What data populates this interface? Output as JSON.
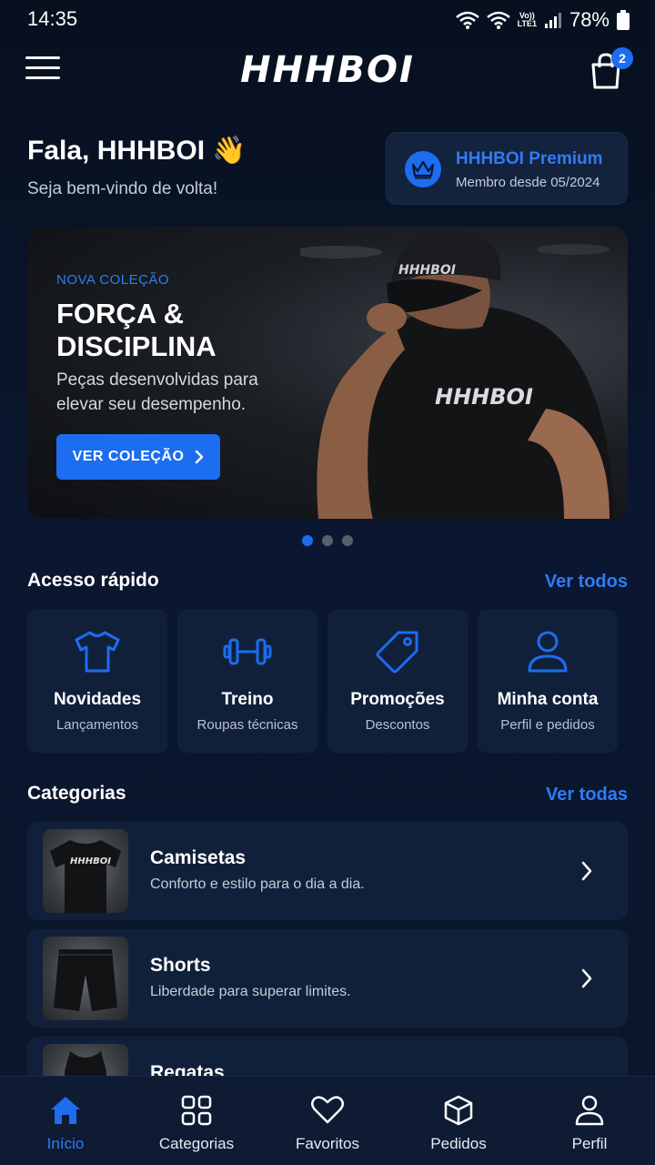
{
  "status_bar": {
    "time": "14:35",
    "volte_top": "Vo))",
    "volte_bottom": "LTE1",
    "battery": "78%"
  },
  "header": {
    "logo": "HHHBOI",
    "cart_count": "2"
  },
  "greeting": {
    "title": "Fala, HHHBOI 👋",
    "subtitle": "Seja bem-vindo de volta!"
  },
  "premium": {
    "title": "HHHBOI Premium",
    "subtitle": "Membro desde 05/2024"
  },
  "hero": {
    "eyebrow": "NOVA COLEÇÃO",
    "title_line1": "FORÇA &",
    "title_line2": "DISCIPLINA",
    "text": "Peças desenvolvidas para elevar seu desempenho.",
    "cta": "VER COLEÇÃO",
    "cap_logo": "HHHBOI",
    "shirt_logo": "HHHBOI",
    "slides": 3,
    "active_slide": 1
  },
  "quick_access": {
    "title": "Acesso rápido",
    "link": "Ver todos",
    "items": [
      {
        "label": "Novidades",
        "sub": "Lançamentos",
        "icon": "tshirt-icon"
      },
      {
        "label": "Treino",
        "sub": "Roupas técnicas",
        "icon": "dumbbell-icon"
      },
      {
        "label": "Promoções",
        "sub": "Descontos",
        "icon": "tag-icon"
      },
      {
        "label": "Minha conta",
        "sub": "Perfil e pedidos",
        "icon": "user-icon"
      }
    ]
  },
  "categories": {
    "title": "Categorias",
    "link": "Ver todas",
    "items": [
      {
        "name": "Camisetas",
        "desc": "Conforto e estilo para o dia a dia.",
        "thumb_logo": "HHHBOI"
      },
      {
        "name": "Shorts",
        "desc": "Liberdade para superar limites."
      },
      {
        "name": "Regatas",
        "desc": ""
      }
    ]
  },
  "bottom_nav": {
    "items": [
      {
        "label": "Início",
        "icon": "home-icon",
        "active": true
      },
      {
        "label": "Categorias",
        "icon": "grid-icon",
        "active": false
      },
      {
        "label": "Favoritos",
        "icon": "heart-icon",
        "active": false
      },
      {
        "label": "Pedidos",
        "icon": "box-icon",
        "active": false
      },
      {
        "label": "Perfil",
        "icon": "user-icon",
        "active": false
      }
    ]
  },
  "colors": {
    "background": "#0a1426",
    "card": "#11203a",
    "accent": "#1c6df0",
    "accent_text": "#2f7cf6"
  }
}
